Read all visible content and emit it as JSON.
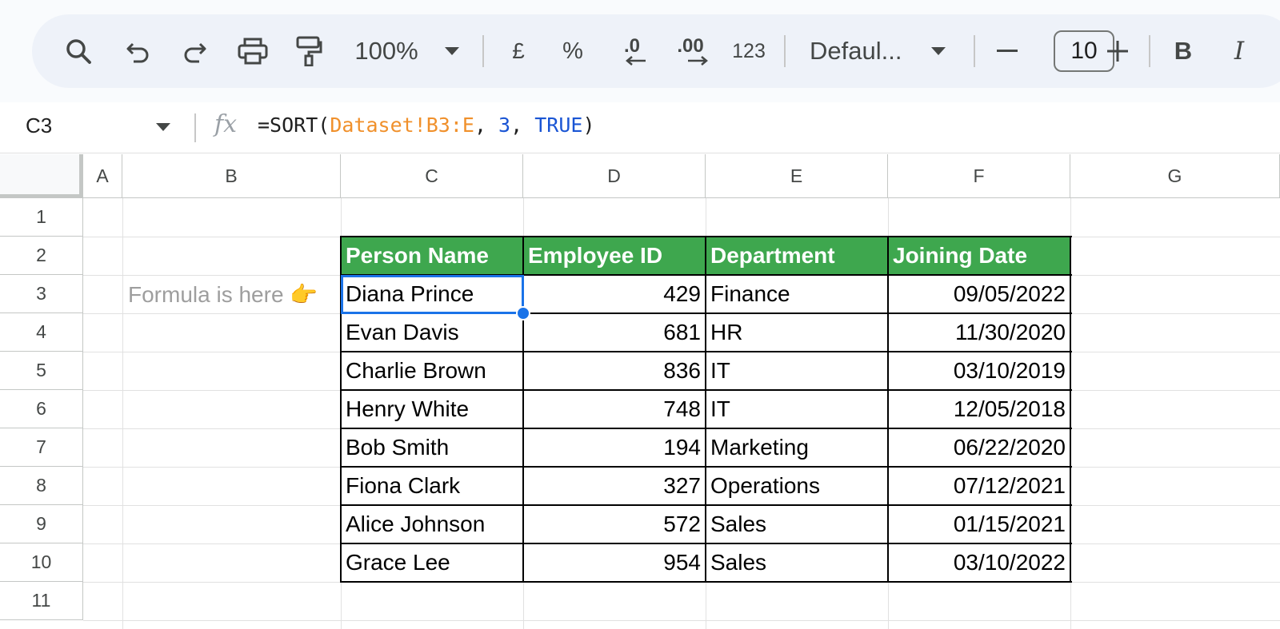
{
  "toolbar": {
    "zoom": "100%",
    "currency": "£",
    "percent": "%",
    "decrease_decimal": ".0",
    "increase_decimal": ".00",
    "number_format": "123",
    "font": "Defaul...",
    "font_size": "10",
    "bold": "B",
    "italic": "I"
  },
  "formula_bar": {
    "cell_ref": "C3",
    "fx": "fx",
    "parts": [
      {
        "text": "=SORT(",
        "color": "#1f1f1f"
      },
      {
        "text": "Dataset!B3:E",
        "color": "#f0902b"
      },
      {
        "text": ", ",
        "color": "#1f1f1f"
      },
      {
        "text": "3",
        "color": "#1a55d4"
      },
      {
        "text": ", ",
        "color": "#1f1f1f"
      },
      {
        "text": "TRUE",
        "color": "#1a55d4"
      },
      {
        "text": ")",
        "color": "#1f1f1f"
      }
    ]
  },
  "columns": [
    "A",
    "B",
    "C",
    "D",
    "E",
    "F",
    "G"
  ],
  "rows": [
    "1",
    "2",
    "3",
    "4",
    "5",
    "6",
    "7",
    "8",
    "9",
    "10",
    "11"
  ],
  "note": "Formula is here 👉",
  "table": {
    "header_color": "#3ea74e",
    "headers": [
      "Person Name",
      "Employee ID",
      "Department",
      "Joining Date"
    ],
    "rows": [
      [
        "Diana Prince",
        "429",
        "Finance",
        "09/05/2022"
      ],
      [
        "Evan Davis",
        "681",
        "HR",
        "11/30/2020"
      ],
      [
        "Charlie Brown",
        "836",
        "IT",
        "03/10/2019"
      ],
      [
        "Henry White",
        "748",
        "IT",
        "12/05/2018"
      ],
      [
        "Bob Smith",
        "194",
        "Marketing",
        "06/22/2020"
      ],
      [
        "Fiona Clark",
        "327",
        "Operations",
        "07/12/2021"
      ],
      [
        "Alice Johnson",
        "572",
        "Sales",
        "01/15/2021"
      ],
      [
        "Grace Lee",
        "954",
        "Sales",
        "03/10/2022"
      ]
    ]
  }
}
